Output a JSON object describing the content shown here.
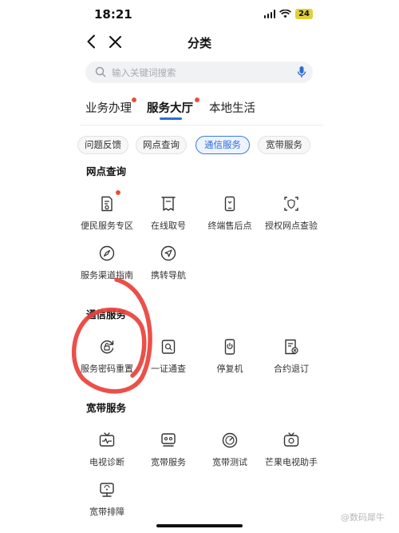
{
  "status": {
    "time": "18:21",
    "battery": "24"
  },
  "nav": {
    "title": "分类"
  },
  "search": {
    "placeholder": "输入关键词搜索"
  },
  "tabs": [
    {
      "label": "业务办理",
      "active": false,
      "dot": true
    },
    {
      "label": "服务大厅",
      "active": true,
      "dot": true
    },
    {
      "label": "本地生活",
      "active": false,
      "dot": false
    }
  ],
  "chips": [
    {
      "label": "问题反馈",
      "active": false
    },
    {
      "label": "网点查询",
      "active": false
    },
    {
      "label": "通信服务",
      "active": true
    },
    {
      "label": "宽带服务",
      "active": false
    }
  ],
  "sections": {
    "outlets": {
      "title": "网点查询",
      "items": [
        {
          "label": "便民服务专区",
          "icon": "service-area-icon"
        },
        {
          "label": "在线取号",
          "icon": "queue-ticket-icon"
        },
        {
          "label": "终端售后点",
          "icon": "device-repair-icon"
        },
        {
          "label": "授权网点查验",
          "icon": "authorized-outlet-icon"
        },
        {
          "label": "服务渠道指南",
          "icon": "compass-icon"
        },
        {
          "label": "携转导航",
          "icon": "navigation-icon"
        }
      ]
    },
    "telecom": {
      "title": "通信服务",
      "items": [
        {
          "label": "服务密码重置",
          "icon": "password-reset-icon"
        },
        {
          "label": "一证通查",
          "icon": "id-check-icon"
        },
        {
          "label": "停复机",
          "icon": "phone-suspend-icon"
        },
        {
          "label": "合约退订",
          "icon": "contract-cancel-icon"
        }
      ]
    },
    "broadband": {
      "title": "宽带服务",
      "items": [
        {
          "label": "电视诊断",
          "icon": "tv-diagnose-icon"
        },
        {
          "label": "宽带服务",
          "icon": "broadband-router-icon"
        },
        {
          "label": "宽带测试",
          "icon": "speed-test-icon"
        },
        {
          "label": "芒果电视助手",
          "icon": "mango-tv-icon"
        },
        {
          "label": "宽带排障",
          "icon": "broadband-troubleshoot-icon"
        }
      ]
    }
  },
  "watermark": "@数码犀牛"
}
